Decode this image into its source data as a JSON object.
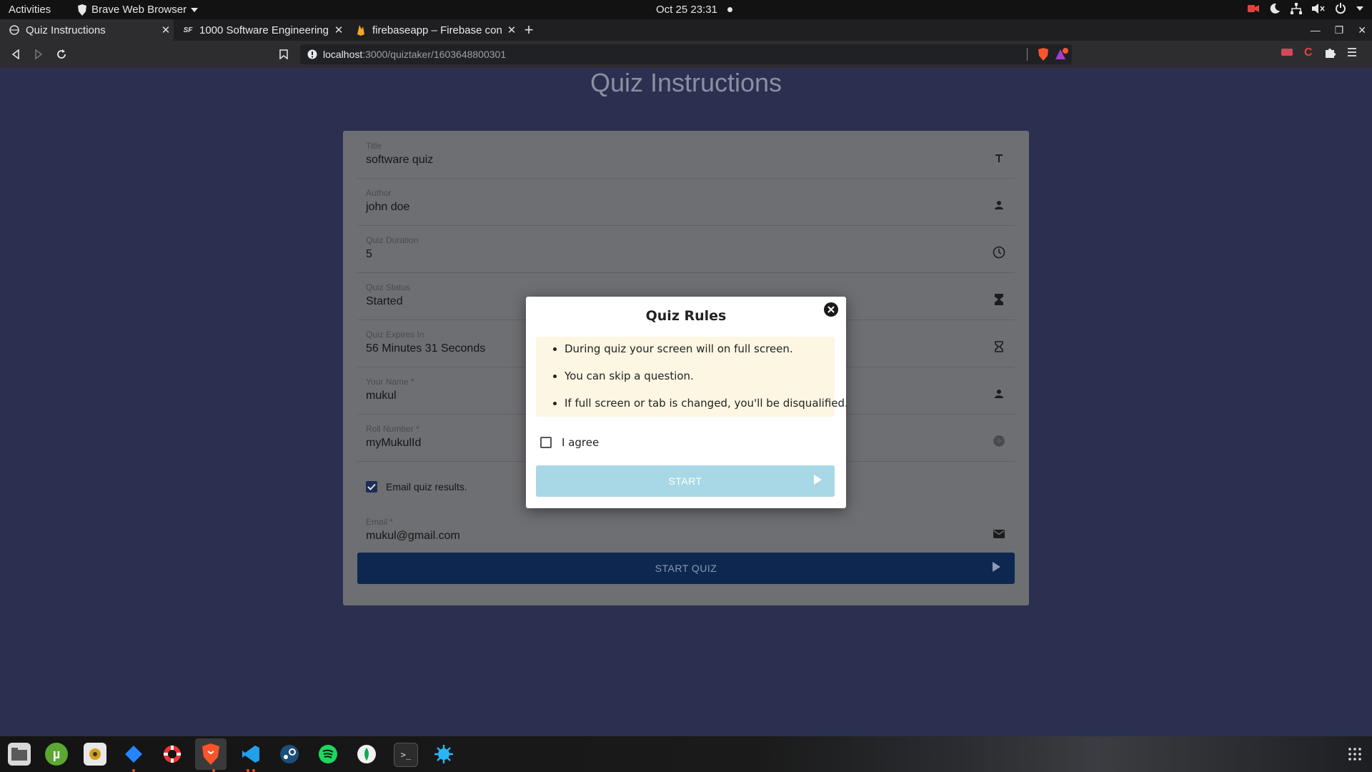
{
  "system": {
    "activities": "Activities",
    "app_menu": "Brave Web Browser",
    "clock": "Oct 25  23:31"
  },
  "browser": {
    "tabs": [
      {
        "title": "Quiz Instructions",
        "active": true
      },
      {
        "title": "1000 Software Engineering",
        "active": false
      },
      {
        "title": "firebaseapp – Firebase con",
        "active": false
      }
    ],
    "url_host": "localhost",
    "url_path": ":3000/quiztaker/1603648800301"
  },
  "page": {
    "title": "Quiz Instructions",
    "fields": [
      {
        "label": "Title",
        "value": "software quiz",
        "icon": "text-format-icon"
      },
      {
        "label": "Author",
        "value": "john doe",
        "icon": "person-icon"
      },
      {
        "label": "Quiz Duration",
        "value": "5",
        "icon": "clock-icon"
      },
      {
        "label": "Quiz Status",
        "value": "Started",
        "icon": "hourglass-full-icon"
      },
      {
        "label": "Quiz Expires In",
        "value": "56 Minutes 31 Seconds",
        "icon": "hourglass-empty-icon"
      },
      {
        "label": "Your Name *",
        "value": "mukul",
        "icon": "person-icon"
      },
      {
        "label": "Roll Number *",
        "value": "myMukulId",
        "icon": "fingerprint-icon"
      }
    ],
    "email_results_label": "Email quiz results.",
    "email_results_checked": true,
    "email": {
      "label": "Email *",
      "value": "mukul@gmail.com",
      "icon": "mail-icon"
    },
    "start_quiz_label": "START QUIZ"
  },
  "modal": {
    "title": "Quiz Rules",
    "rules": [
      "During quiz your screen will on full screen.",
      "You can skip a question.",
      "If full screen or tab is changed, you'll be disqualified."
    ],
    "agree_label": "I agree",
    "agree_checked": false,
    "start_label": "START"
  },
  "colors": {
    "page_bg": "#2b3050",
    "card_bg": "#6e6f73",
    "start_quiz_bg": "#0d2750",
    "modal_start_bg": "#a8d8e6",
    "rules_bg": "#fdf6e3"
  }
}
